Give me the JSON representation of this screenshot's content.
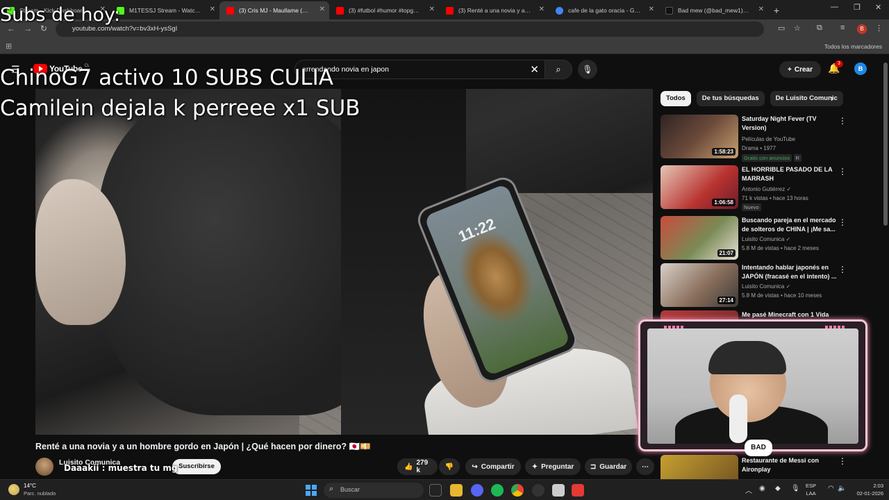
{
  "browser": {
    "tabs": [
      {
        "label": "Stream - Kick Dashboard",
        "color": "#53fc18",
        "active": false
      },
      {
        "label": "M1TESSJ Stream - Watch Live o",
        "color": "#53fc18",
        "active": false
      },
      {
        "label": "(3) Cris MJ - Maullame (Video",
        "color": "#ff0000",
        "active": true
      },
      {
        "label": "(3) #futbol #humor #topgoles",
        "color": "#ff0000",
        "active": false
      },
      {
        "label": "(3) Renté a una novia y a un ho",
        "color": "#ff0000",
        "active": false
      },
      {
        "label": "cafe de la gato oracia - Google",
        "color": "#4285f4",
        "active": false
      },
      {
        "label": "Bad mew (@bad_mew1) | TikTo",
        "color": "#111111",
        "active": false
      }
    ],
    "new_tab": "+",
    "url": "youtube.com/watch?v=bv3xH-ysSgI",
    "profile_initial": "B",
    "bookmarks_all": "Todos los marcadores"
  },
  "youtube": {
    "logo_text": "YouTube",
    "country": "CL",
    "search_query": "arrendando novia en japon",
    "create_label": "Crear",
    "notif_count": "3",
    "avatar_initial": "B",
    "chips": [
      "Todos",
      "De tus búsquedas",
      "De Luisito Comunic"
    ],
    "video": {
      "title": "Renté a una novia y a un hombre gordo en Japón | ¿Qué hacen por dinero? 🇯🇵💴",
      "channel": "Luisito Comunica",
      "subscribe": "Suscribirse",
      "likes": "279 k",
      "share": "Compartir",
      "ask": "Preguntar",
      "save": "Guardar",
      "phone_clock": "11:22"
    },
    "recommendations": [
      {
        "title": "Saturday Night Fever (TV Version)",
        "channel": "Películas de YouTube",
        "meta": "Drama • 1977",
        "badge": "Gratis con anuncios",
        "badge2": "R",
        "duration": "1:58:23",
        "thumb": "#6b4a3a"
      },
      {
        "title": "EL HORRIBLE PASADO DE LA MARRASH",
        "channel": "Antonio Gutiérrez ✓",
        "meta": "71 k vistas • hace 13 horas",
        "badge": "Nuevo",
        "duration": "1:06:58",
        "thumb": "#b8322f"
      },
      {
        "title": "Buscando pareja en el mercado de solteros de CHINA | ¡Me sa...",
        "channel": "Luisito Comunica ✓",
        "meta": "5.8 M de vistas • hace 2 meses",
        "duration": "21:07",
        "thumb": "#7a8a55"
      },
      {
        "title": "Intentando hablar japonés en JAPÓN (fracasé en el intento) ...",
        "channel": "Luisito Comunica ✓",
        "meta": "5.8 M de vistas • hace 10 meses",
        "duration": "27:14",
        "thumb": "#8a6f5c"
      },
      {
        "title": "Me pasé Minecraft con 1 Vida",
        "duration": "",
        "thumb": "#b23a3a"
      },
      {
        "title": "Restaurante de Messi con Aironplay",
        "duration": "",
        "thumb": "#c6a030"
      }
    ]
  },
  "overlay": {
    "subs_header": "Subs de hoy:",
    "line1": "ChinoG7 activo 10 SUBS CULIA",
    "line2": "Camilein dejala k perreee x1 SUB",
    "chat_msg": "Daaakii : muestra tu mg",
    "cam_logo": "BAD"
  },
  "taskbar": {
    "temp": "14°C",
    "weather": "Parc. nublado",
    "search": "Buscar",
    "lang1": "ESP",
    "lang2": "LAA",
    "time": "2:03",
    "date": "02-01-2026"
  }
}
